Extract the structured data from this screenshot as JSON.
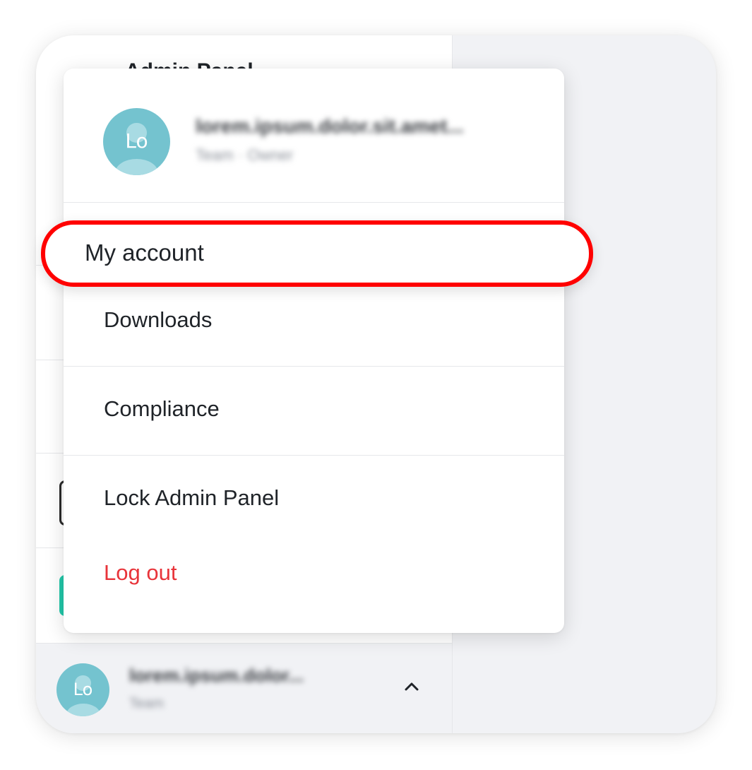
{
  "sidebar": {
    "title": "Admin Panel"
  },
  "user": {
    "initials": "Lo",
    "name": "lorem.ipsum.dolor.sit.amet...",
    "footer_name": "lorem.ipsum.dolor...",
    "role": "Team",
    "role_detail": "Team · Owner"
  },
  "menu": {
    "my_account": "My account",
    "downloads": "Downloads",
    "compliance": "Compliance",
    "lock_admin_panel": "Lock Admin Panel",
    "log_out": "Log out"
  },
  "colors": {
    "highlight": "#ff0000",
    "logout": "#e8343a",
    "avatar": "#74c3cf"
  }
}
